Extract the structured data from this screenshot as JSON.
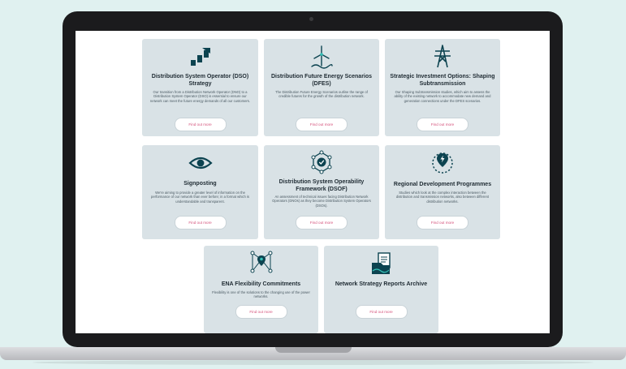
{
  "colors": {
    "background": "#e0f1f0",
    "card": "#d9e2e6",
    "icon": "#0c4350",
    "accent": "#35c0b6",
    "link": "#d4507a"
  },
  "cards": [
    {
      "icon": "steps-arrow-icon",
      "title": "Distribution System Operator (DSO) Strategy",
      "description": "Our transition from a Distribution Network Operator (DNO) to a Distribution System Operator (DSO) is essential to ensure our network can meet the future energy demands of all our customers.",
      "button": "Find out more"
    },
    {
      "icon": "wind-turbine-icon",
      "title": "Distribution Future Energy Scenarios (DFES)",
      "description": "The Distribution Future Energy Scenarios outline the range of credible futures for the growth of the distribution network.",
      "button": "Find out more"
    },
    {
      "icon": "pylon-icon",
      "title": "Strategic Investment Options: Shaping Subtransmission",
      "description": "Our Shaping Subtransmission studies, which aim to assess the ability of the existing network to accommodate new demand and generation connections under the DFES scenarios.",
      "button": "Find out more"
    },
    {
      "icon": "eye-icon",
      "title": "Signposting",
      "description": "We're aiming to provide a greater level of information on the performance of our network than ever before; in a format which is understandable and transparent.",
      "button": "Find out more"
    },
    {
      "icon": "operability-check-icon",
      "title": "Distribution System Operability Framework (DSOF)",
      "description": "An assessment of technical issues facing Distribution Network Operators (DNOs) as they become Distribution System Operators (DSOs).",
      "button": "Find out more"
    },
    {
      "icon": "location-bolt-icon",
      "title": "Regional Development Programmes",
      "description": "Studies which look at the complex interaction between the distribution and transmission networks, also between different distribution networks.",
      "button": "Find out more"
    },
    {
      "icon": "network-pin-icon",
      "title": "ENA Flexibility Commitments",
      "description": "Flexibility is one of the solutions to the changing use of the power networks.",
      "button": "Find out more"
    },
    {
      "icon": "reports-archive-icon",
      "title": "Network Strategy Reports Archive",
      "description": "",
      "button": "Find out more"
    }
  ]
}
